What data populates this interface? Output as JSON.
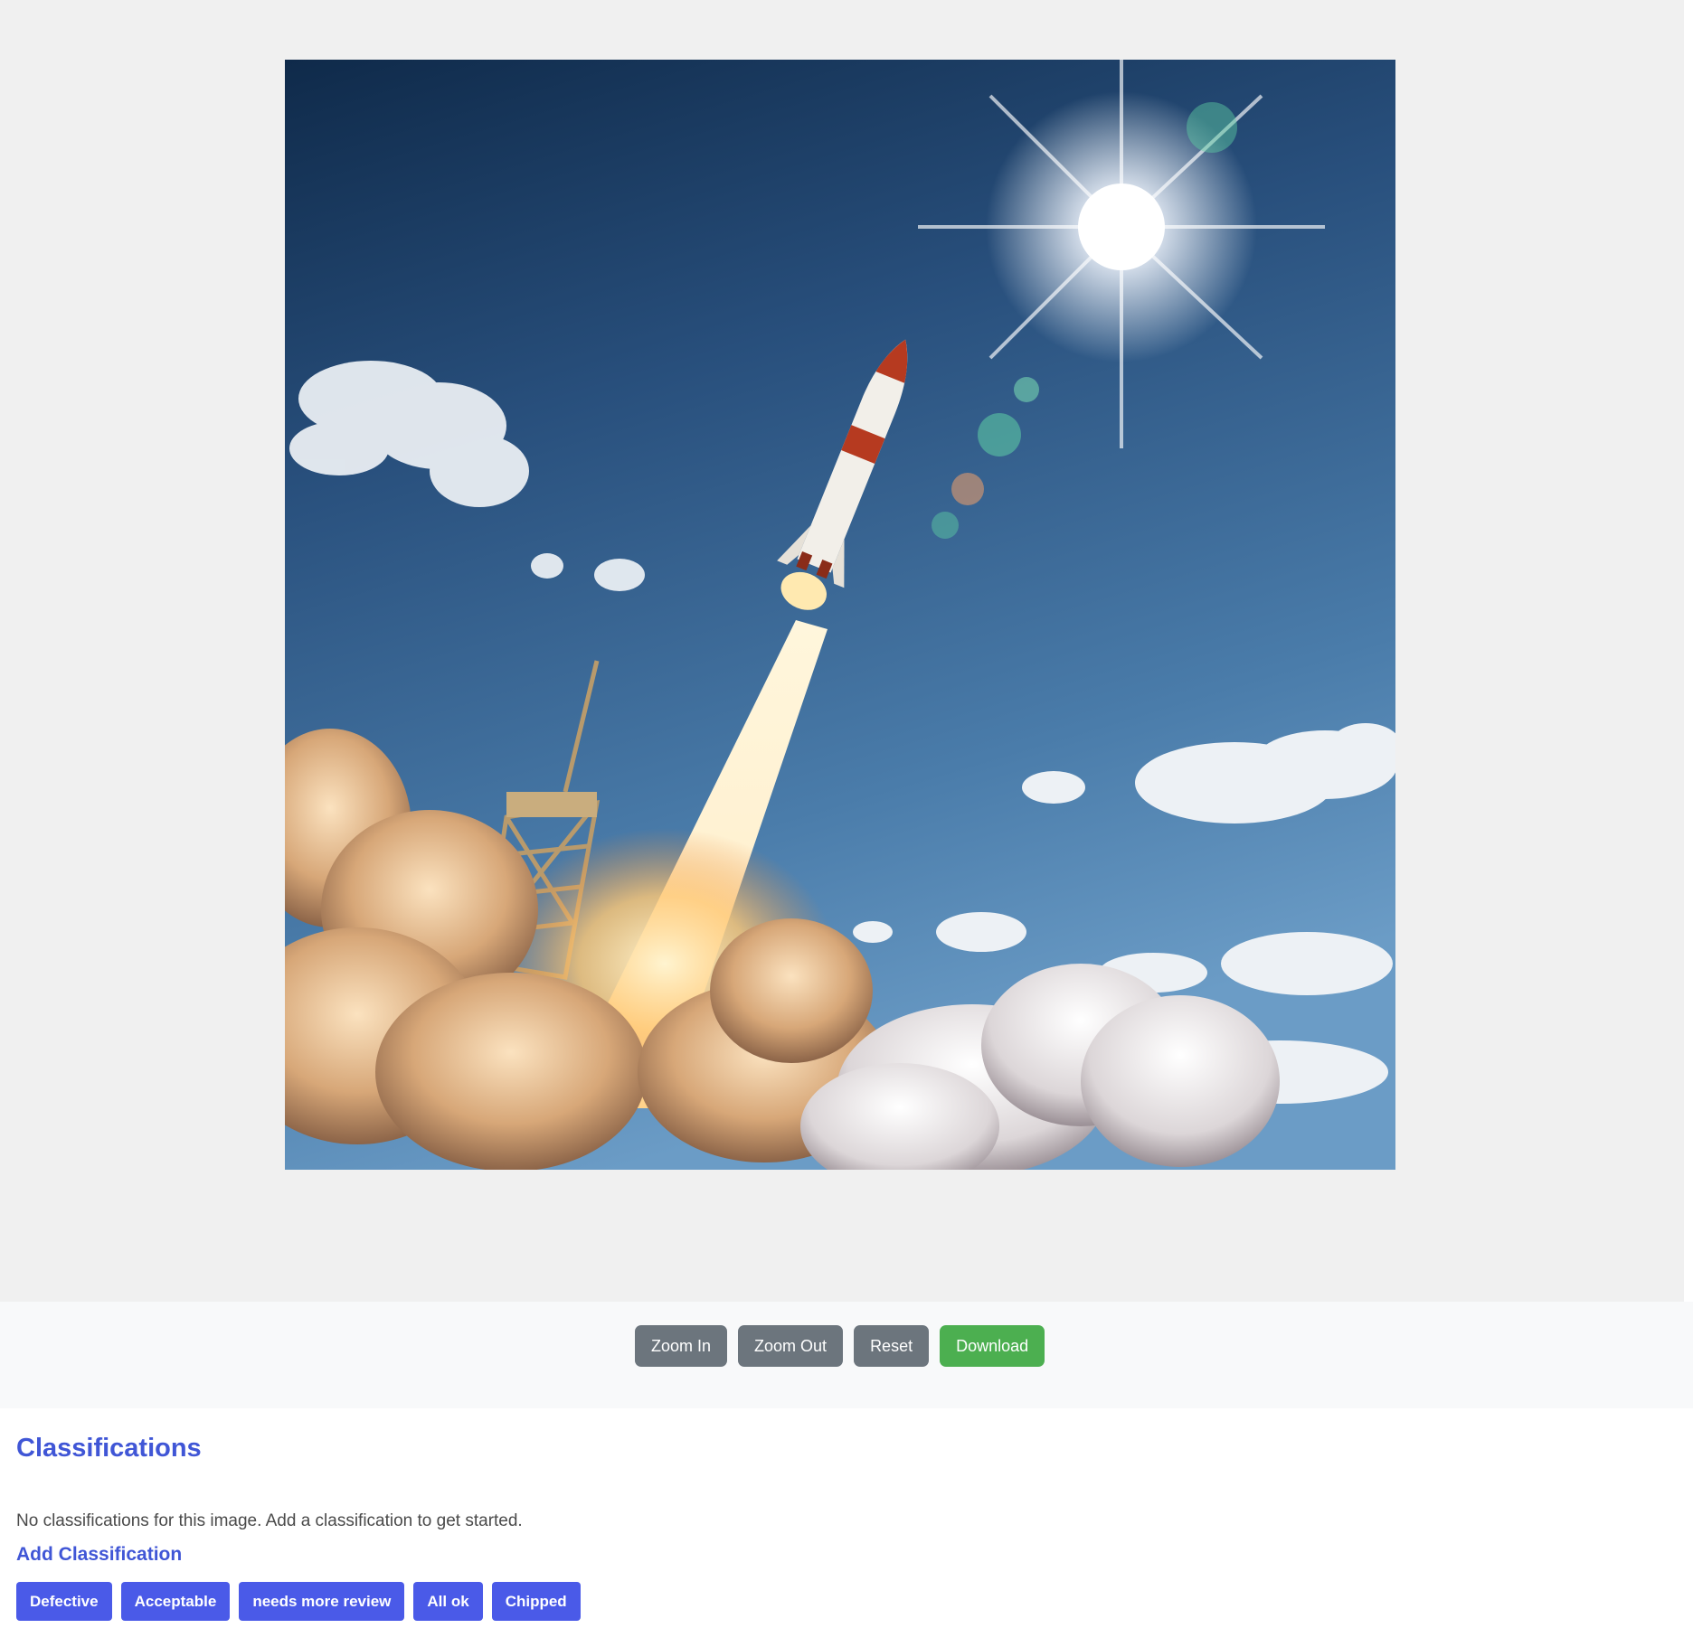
{
  "viewer": {
    "image_description": "rocket-launch-photo"
  },
  "toolbar": {
    "zoom_in": "Zoom In",
    "zoom_out": "Zoom Out",
    "reset": "Reset",
    "download": "Download"
  },
  "classifications": {
    "title": "Classifications",
    "empty_message": "No classifications for this image. Add a classification to get started.",
    "add_title": "Add Classification",
    "options": [
      "Defective",
      "Acceptable",
      "needs more review",
      "All ok",
      "Chipped"
    ]
  },
  "colors": {
    "accent": "#4056d6",
    "chip": "#4a5ae8",
    "toolbar_button": "#6c757d",
    "download_button": "#4caf50"
  }
}
